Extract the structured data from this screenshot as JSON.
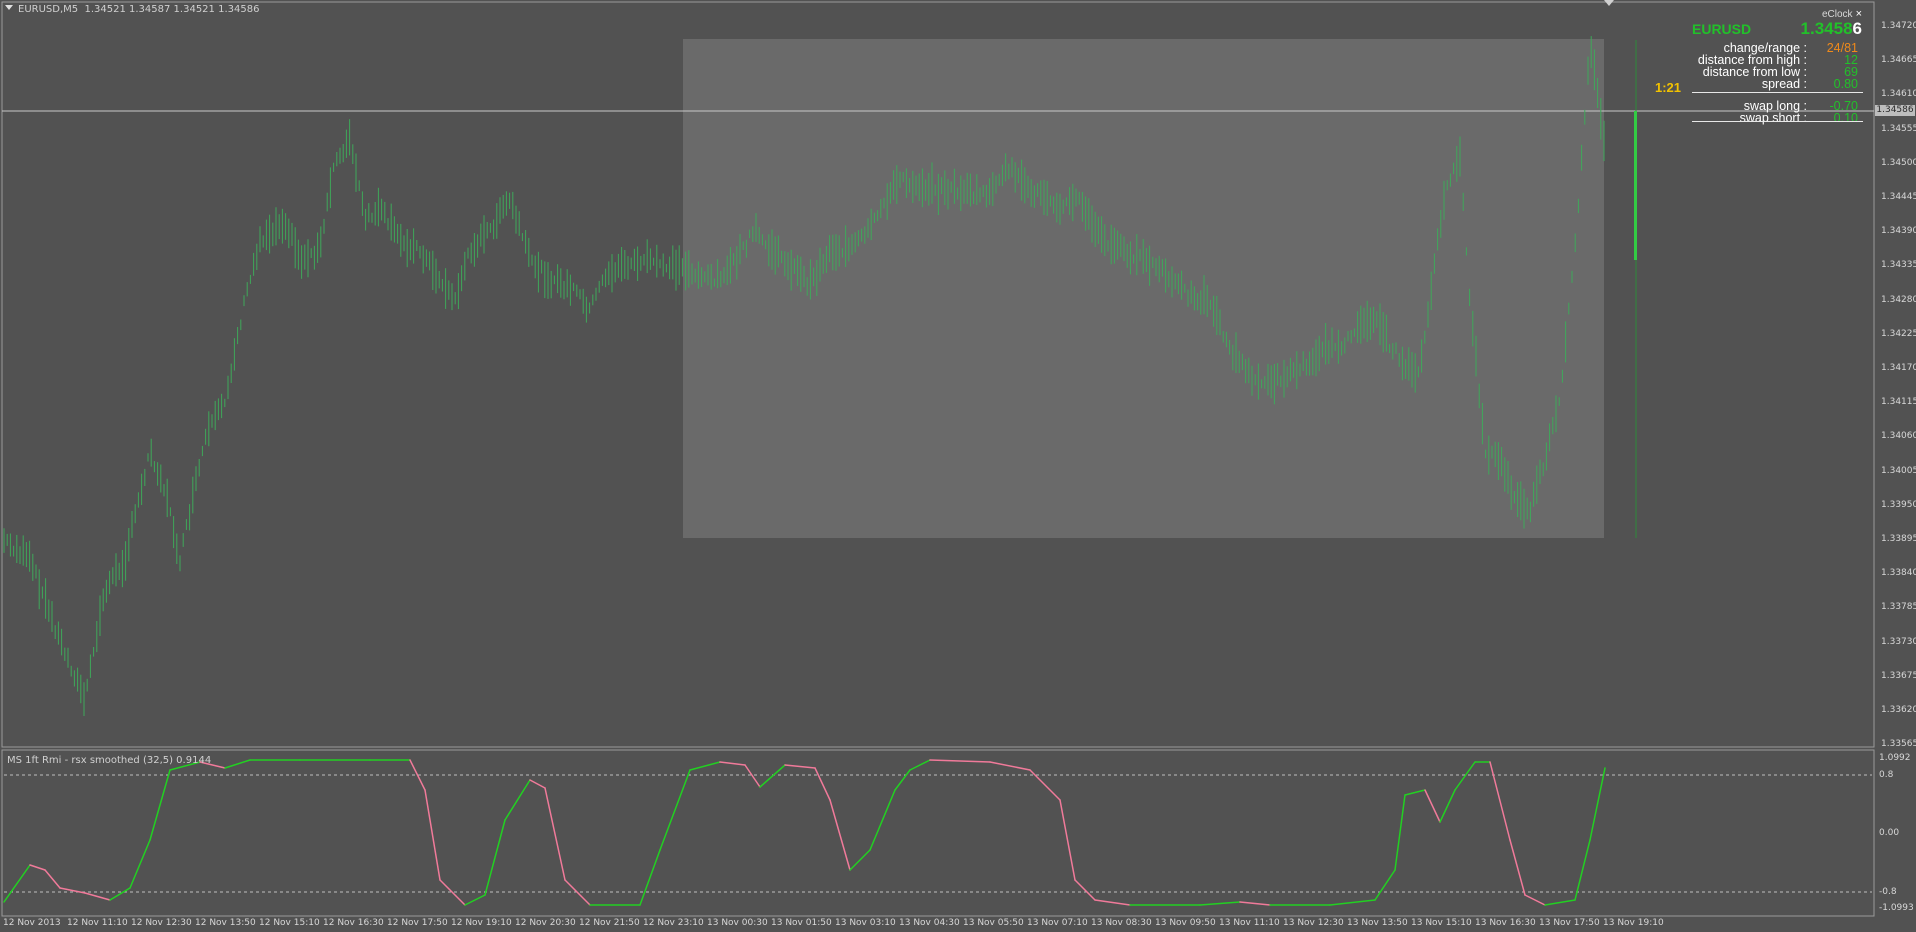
{
  "window": {
    "symbol_tf": "EURUSD,M5",
    "ohlc": "1.34521 1.34587 1.34521 1.34586"
  },
  "indicator": {
    "title": "MS 1ft Rmi - rsx smoothed (32,5) 0.9144",
    "axis_labels": [
      "1.0992",
      "0.8",
      "0.00",
      "-0.8",
      "-1.0993"
    ]
  },
  "price_axis": {
    "labels": [
      "1.34720",
      "1.34665",
      "1.34610",
      "1.34555",
      "1.34500",
      "1.34445",
      "1.34390",
      "1.34335",
      "1.34280",
      "1.34225",
      "1.34170",
      "1.34115",
      "1.34060",
      "1.34005",
      "1.33950",
      "1.33895",
      "1.33840",
      "1.33785",
      "1.33730",
      "1.33675",
      "1.33620",
      "1.33565"
    ],
    "current_price_tag": "1.34586"
  },
  "time_axis": {
    "labels": [
      "12 Nov 2013",
      "12 Nov 11:10",
      "12 Nov 12:30",
      "12 Nov 13:50",
      "12 Nov 15:10",
      "12 Nov 16:30",
      "12 Nov 17:50",
      "12 Nov 19:10",
      "12 Nov 20:30",
      "12 Nov 21:50",
      "12 Nov 23:10",
      "13 Nov 00:30",
      "13 Nov 01:50",
      "13 Nov 03:10",
      "13 Nov 04:30",
      "13 Nov 05:50",
      "13 Nov 07:10",
      "13 Nov 08:30",
      "13 Nov 09:50",
      "13 Nov 11:10",
      "13 Nov 12:30",
      "13 Nov 13:50",
      "13 Nov 15:10",
      "13 Nov 16:30",
      "13 Nov 17:50",
      "13 Nov 19:10"
    ]
  },
  "eclock": {
    "title": "eClock",
    "close": "×",
    "symbol": "EURUSD",
    "bid_main": "1.3458",
    "bid_last": "6",
    "rows": [
      {
        "label": "change/range :",
        "value": "24/81",
        "color": "#f08a1a"
      },
      {
        "label": "distance from high :",
        "value": "12",
        "color": "#22c02a"
      },
      {
        "label": "distance from low :",
        "value": "69",
        "color": "#22c02a"
      },
      {
        "label": "spread :",
        "value": "0.80",
        "color": "#22c02a"
      },
      {
        "label": "swap long :",
        "value": "-0.70",
        "color": "#22c02a"
      },
      {
        "label": "swap short :",
        "value": "0.10",
        "color": "#22c02a"
      }
    ],
    "timer": "1:21"
  },
  "colors": {
    "background": "#525252",
    "highlight_box": "#6a6a6a",
    "candle": "#3fa85a",
    "ind_up": "#22d022",
    "ind_down": "#f07a9a"
  }
}
